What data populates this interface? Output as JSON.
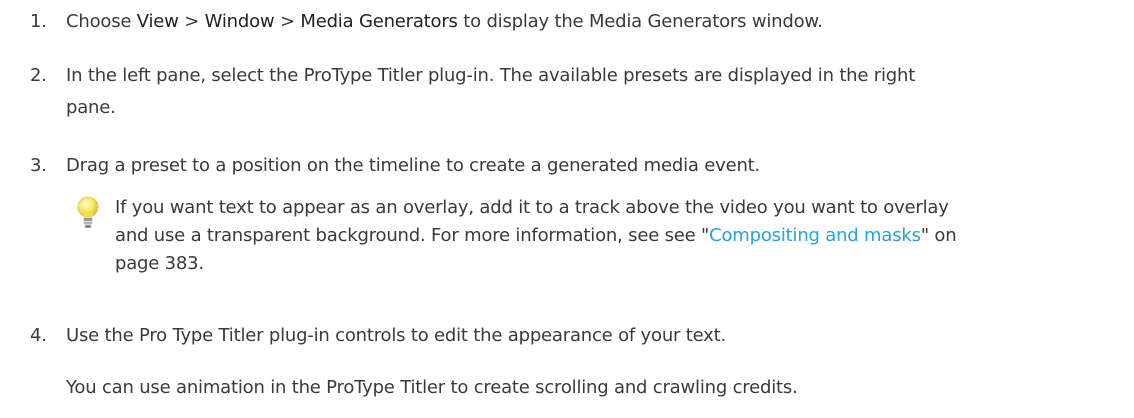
{
  "steps": [
    {
      "number": "1.",
      "text_before": "Choose ",
      "ui_view": "View",
      "sep1": " > ",
      "ui_window": "Window",
      "sep2": " > ",
      "ui_media": "Media Generators",
      "text_after": " to display the Media Generators window."
    },
    {
      "number": "2.",
      "line1": "In the left pane, select the ProType Titler plug-in. The available presets are displayed in the right",
      "line2": "pane."
    },
    {
      "number": "3.",
      "text": "Drag a preset to a position on the timeline to create a generated media event."
    },
    {
      "number": "4.",
      "text": "Use the Pro Type Titler plug-in controls to edit the appearance of your text."
    }
  ],
  "tip": {
    "icon": "lightbulb-icon",
    "line1": "If you want text to appear as an overlay, add it to a track above the video you want to overlay",
    "line2_before": "and use a transparent background. For more information, see see \"",
    "link_text": "Compositing and masks",
    "line2_after": "\" on",
    "line3": "page 383."
  },
  "note": "You can use animation in the ProType Titler to create scrolling and crawling credits.",
  "colors": {
    "text": "#3a3a3a",
    "link": "#2aa2d4",
    "bulb": "#f2e15c"
  }
}
